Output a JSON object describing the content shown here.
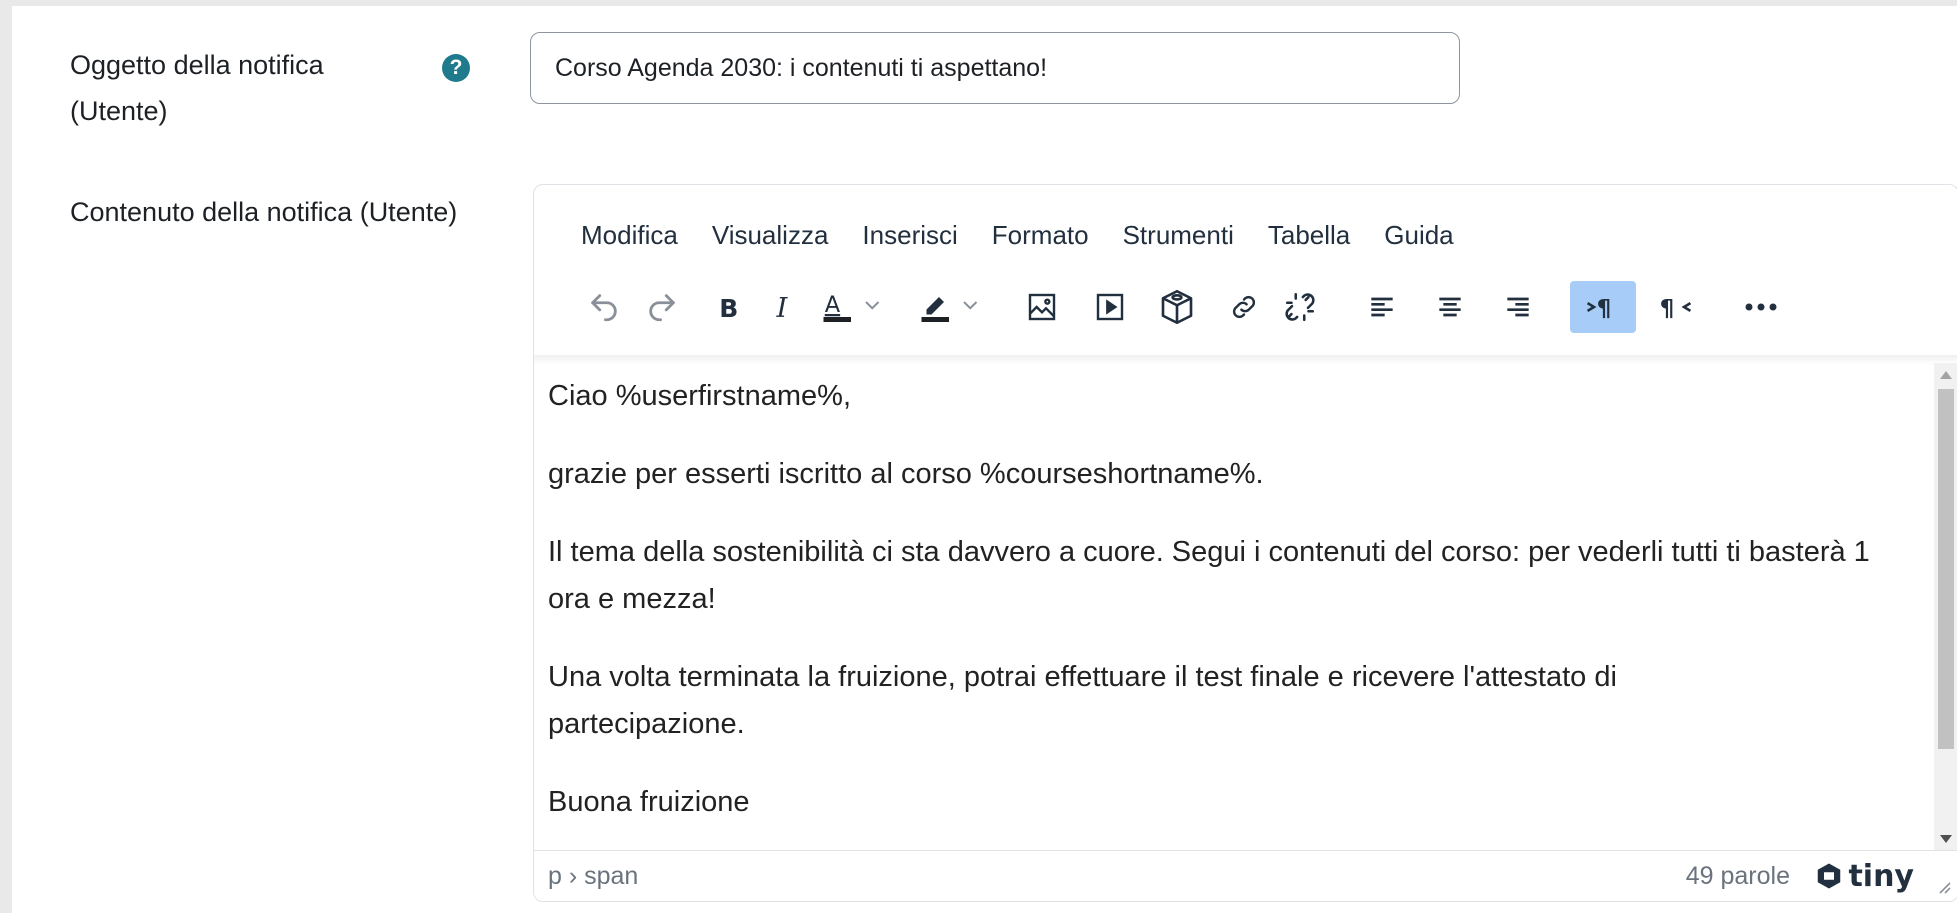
{
  "subject": {
    "label": "Oggetto della notifica\n(Utente)",
    "label_line1": "Oggetto della notifica",
    "label_line2": "(Utente)",
    "help_icon": "?",
    "value": "Corso Agenda 2030: i contenuti ti aspettano!"
  },
  "content_field": {
    "label": "Contenuto della notifica (Utente)"
  },
  "editor": {
    "menu": [
      "Modifica",
      "Visualizza",
      "Inserisci",
      "Formato",
      "Strumenti",
      "Tabella",
      "Guida"
    ],
    "toolbar": [
      "undo-icon",
      "redo-icon",
      "bold-icon",
      "italic-icon",
      "text-color-icon",
      "highlight-color-icon",
      "image-icon",
      "media-icon",
      "h5p-icon",
      "link-icon",
      "unlink-icon",
      "align-left-icon",
      "align-center-icon",
      "align-right-icon",
      "ltr-icon",
      "rtl-icon",
      "more-icon"
    ],
    "active_button": "ltr-icon",
    "paragraphs": [
      "Ciao %userfirstname%,",
      "grazie per esserti iscritto al corso %courseshortname%.",
      "Il tema della sostenibilità ci sta davvero a cuore. Segui i contenuti del corso: per vederli tutti ti basterà 1 ora e mezza!",
      "Una volta terminata la fruizione, potrai effettuare il test finale e ricevere l'attestato di partecipazione.",
      "Buona fruizione"
    ],
    "status": {
      "path": "p › span",
      "word_count": "49 parole",
      "brand": "tiny"
    }
  },
  "colors": {
    "accent": "#1f7a8c",
    "active_button_bg": "#a6ccf7",
    "text_color_bar": "#1d2125"
  }
}
